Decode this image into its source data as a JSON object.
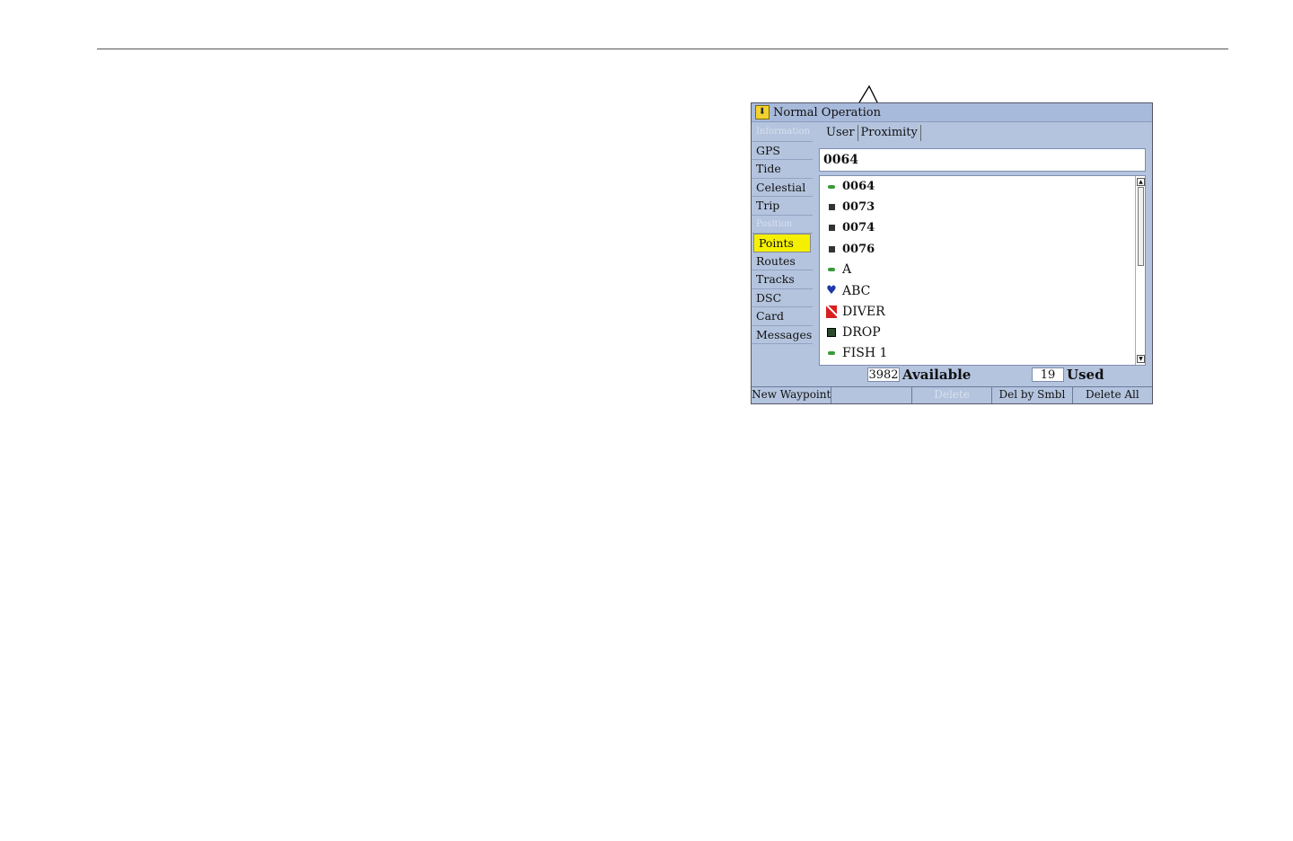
{
  "window": {
    "title": "Normal Operation"
  },
  "sidebar": {
    "items": [
      {
        "label": "Information",
        "disabled": true
      },
      {
        "label": "GPS"
      },
      {
        "label": "Tide"
      },
      {
        "label": "Celestial"
      },
      {
        "label": "Trip"
      },
      {
        "label": "Position",
        "disabled": true
      },
      {
        "label": "Points",
        "selected": true
      },
      {
        "label": "Routes"
      },
      {
        "label": "Tracks"
      },
      {
        "label": "DSC"
      },
      {
        "label": "Card"
      },
      {
        "label": "Messages"
      }
    ]
  },
  "tabs": [
    {
      "label": "User"
    },
    {
      "label": "Proximity"
    }
  ],
  "search": {
    "value": "0064"
  },
  "waypoints": [
    {
      "name": "0064",
      "symbol": "flag-icon"
    },
    {
      "name": "0073",
      "symbol": "square-icon"
    },
    {
      "name": "0074",
      "symbol": "square-icon"
    },
    {
      "name": "0076",
      "symbol": "square-icon"
    },
    {
      "name": "A",
      "symbol": "flag-icon"
    },
    {
      "name": "ABC",
      "symbol": "heart-icon"
    },
    {
      "name": "DIVER",
      "symbol": "diver-flag-icon"
    },
    {
      "name": "DROP",
      "symbol": "drop-icon"
    },
    {
      "name": "FISH 1",
      "symbol": "flag-icon"
    }
  ],
  "counts": {
    "available_value": "3982",
    "available_label": "Available",
    "used_value": "19",
    "used_label": "Used"
  },
  "softkeys": {
    "new_waypoint": "New Waypoint",
    "blank": "",
    "delete": "Delete",
    "del_by_symbol": "Del by Smbl",
    "delete_all": "Delete All"
  }
}
